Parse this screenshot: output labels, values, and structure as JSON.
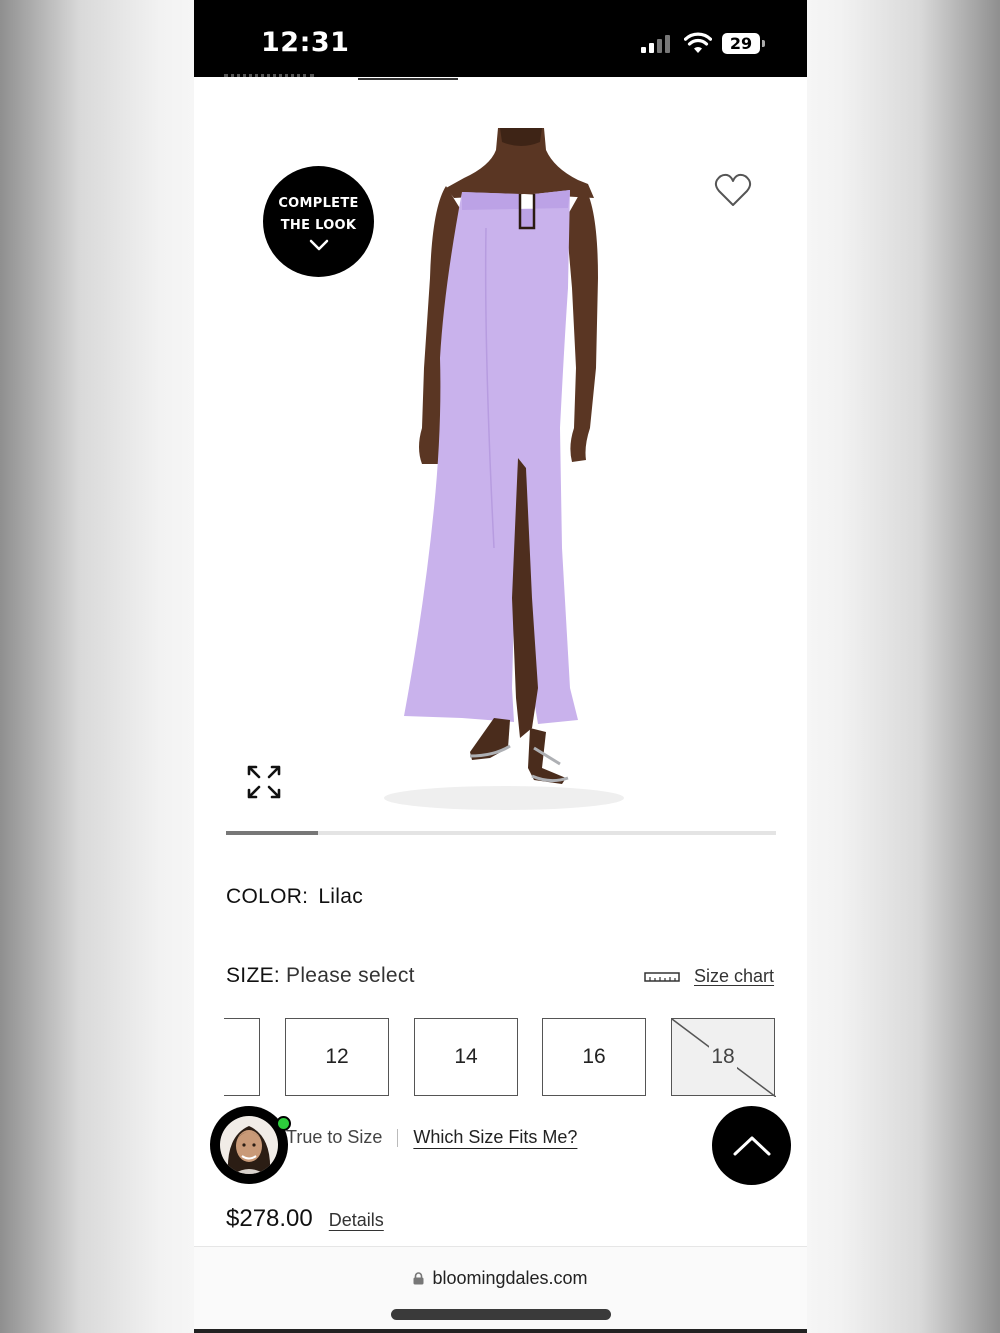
{
  "status_bar": {
    "time": "12:31",
    "battery": "29"
  },
  "complete_look": {
    "line1": "COMPLETE",
    "line2": "THE LOOK"
  },
  "image_carousel": {
    "progress_fraction": 0.167
  },
  "color": {
    "label": "COLOR:",
    "value": "Lilac"
  },
  "size": {
    "label": "SIZE:",
    "value": "Please select",
    "chart_label": "Size chart",
    "options": [
      "12",
      "14",
      "16",
      "18"
    ],
    "unavailable": [
      "18"
    ]
  },
  "fit": {
    "true_to_size": "True to Size",
    "which_size": "Which Size Fits Me?"
  },
  "price": {
    "amount": "$278.00",
    "details_label": "Details"
  },
  "browser": {
    "url": "bloomingdales.com"
  },
  "colors": {
    "dress": "#c9b2ec",
    "accent": "#000000",
    "online_dot": "#2dcc3c"
  }
}
